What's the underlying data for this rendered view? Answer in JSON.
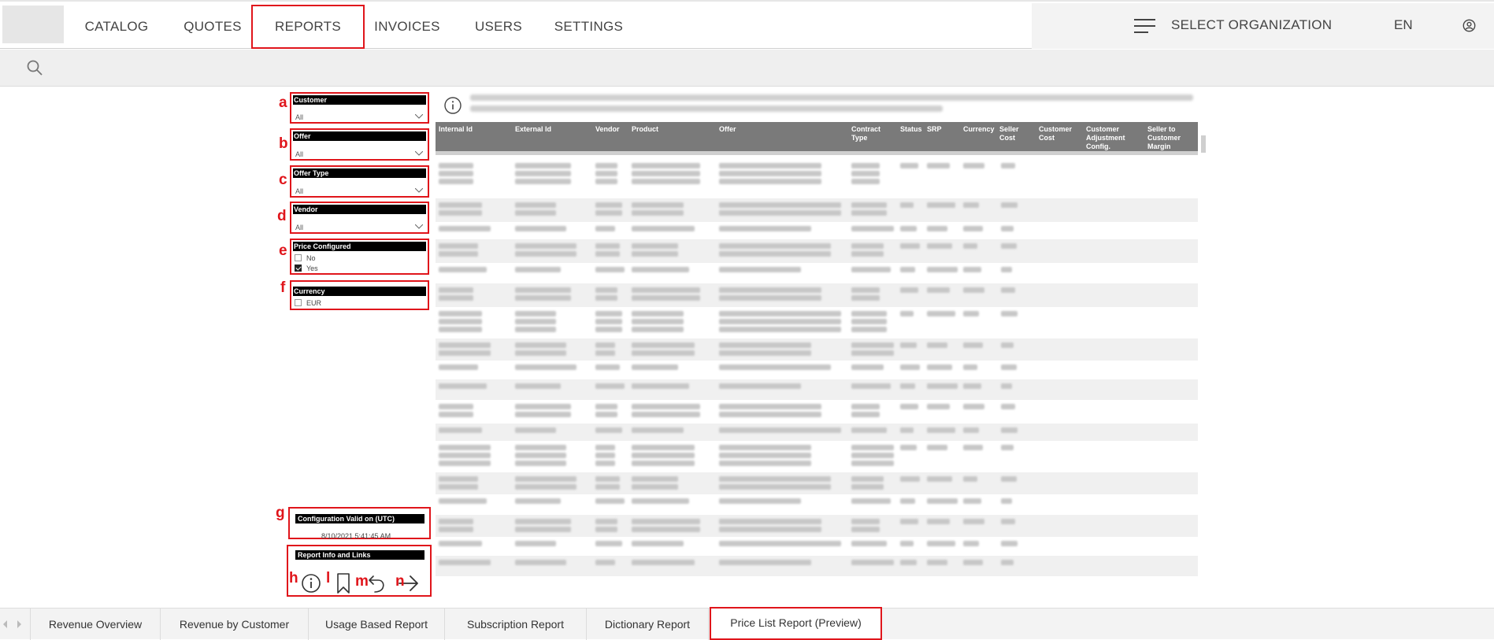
{
  "nav": {
    "items": [
      {
        "label": "CATALOG",
        "active": false
      },
      {
        "label": "QUOTES",
        "active": false
      },
      {
        "label": "REPORTS",
        "active": true
      },
      {
        "label": "INVOICES",
        "active": false
      },
      {
        "label": "USERS",
        "active": false
      },
      {
        "label": "SETTINGS",
        "active": false
      }
    ],
    "org_label": "SELECT ORGANIZATION",
    "language": "EN"
  },
  "filters": {
    "customer": {
      "title": "Customer",
      "value": "All"
    },
    "offer": {
      "title": "Offer",
      "value": "All"
    },
    "offer_type": {
      "title": "Offer Type",
      "value": "All"
    },
    "vendor": {
      "title": "Vendor",
      "value": "All"
    },
    "price_configured": {
      "title": "Price Configured",
      "options": [
        {
          "label": "No",
          "checked": false
        },
        {
          "label": "Yes",
          "checked": true
        }
      ]
    },
    "currency": {
      "title": "Currency",
      "options": [
        {
          "label": "EUR",
          "checked": false
        }
      ]
    }
  },
  "config": {
    "title": "Configuration Valid on (UTC)",
    "value": "8/10/2021 5:41:45 AM"
  },
  "links": {
    "title": "Report Info and Links"
  },
  "annotations": {
    "a": "a",
    "b": "b",
    "c": "c",
    "d": "d",
    "e": "e",
    "f": "f",
    "g": "g",
    "h": "h",
    "l": "l",
    "m": "m",
    "n": "n"
  },
  "table": {
    "columns": [
      "Internal Id",
      "External Id",
      "Vendor",
      "Product",
      "Offer",
      "Contract Type",
      "Status",
      "SRP",
      "Currency",
      "Seller Cost",
      "Customer Cost",
      "Customer Adjustment Config.",
      "Seller to Customer Margin"
    ]
  },
  "tabs": [
    {
      "label": "Revenue Overview",
      "active": false
    },
    {
      "label": "Revenue by Customer",
      "active": false
    },
    {
      "label": "Usage Based Report",
      "active": false
    },
    {
      "label": "Subscription Report",
      "active": false
    },
    {
      "label": "Dictionary Report",
      "active": false
    },
    {
      "label": "Price List Report (Preview)",
      "active": true
    }
  ],
  "colors": {
    "accent": "#e0151b",
    "header_bg": "#7a7a7a",
    "slicer_header": "#000000"
  }
}
